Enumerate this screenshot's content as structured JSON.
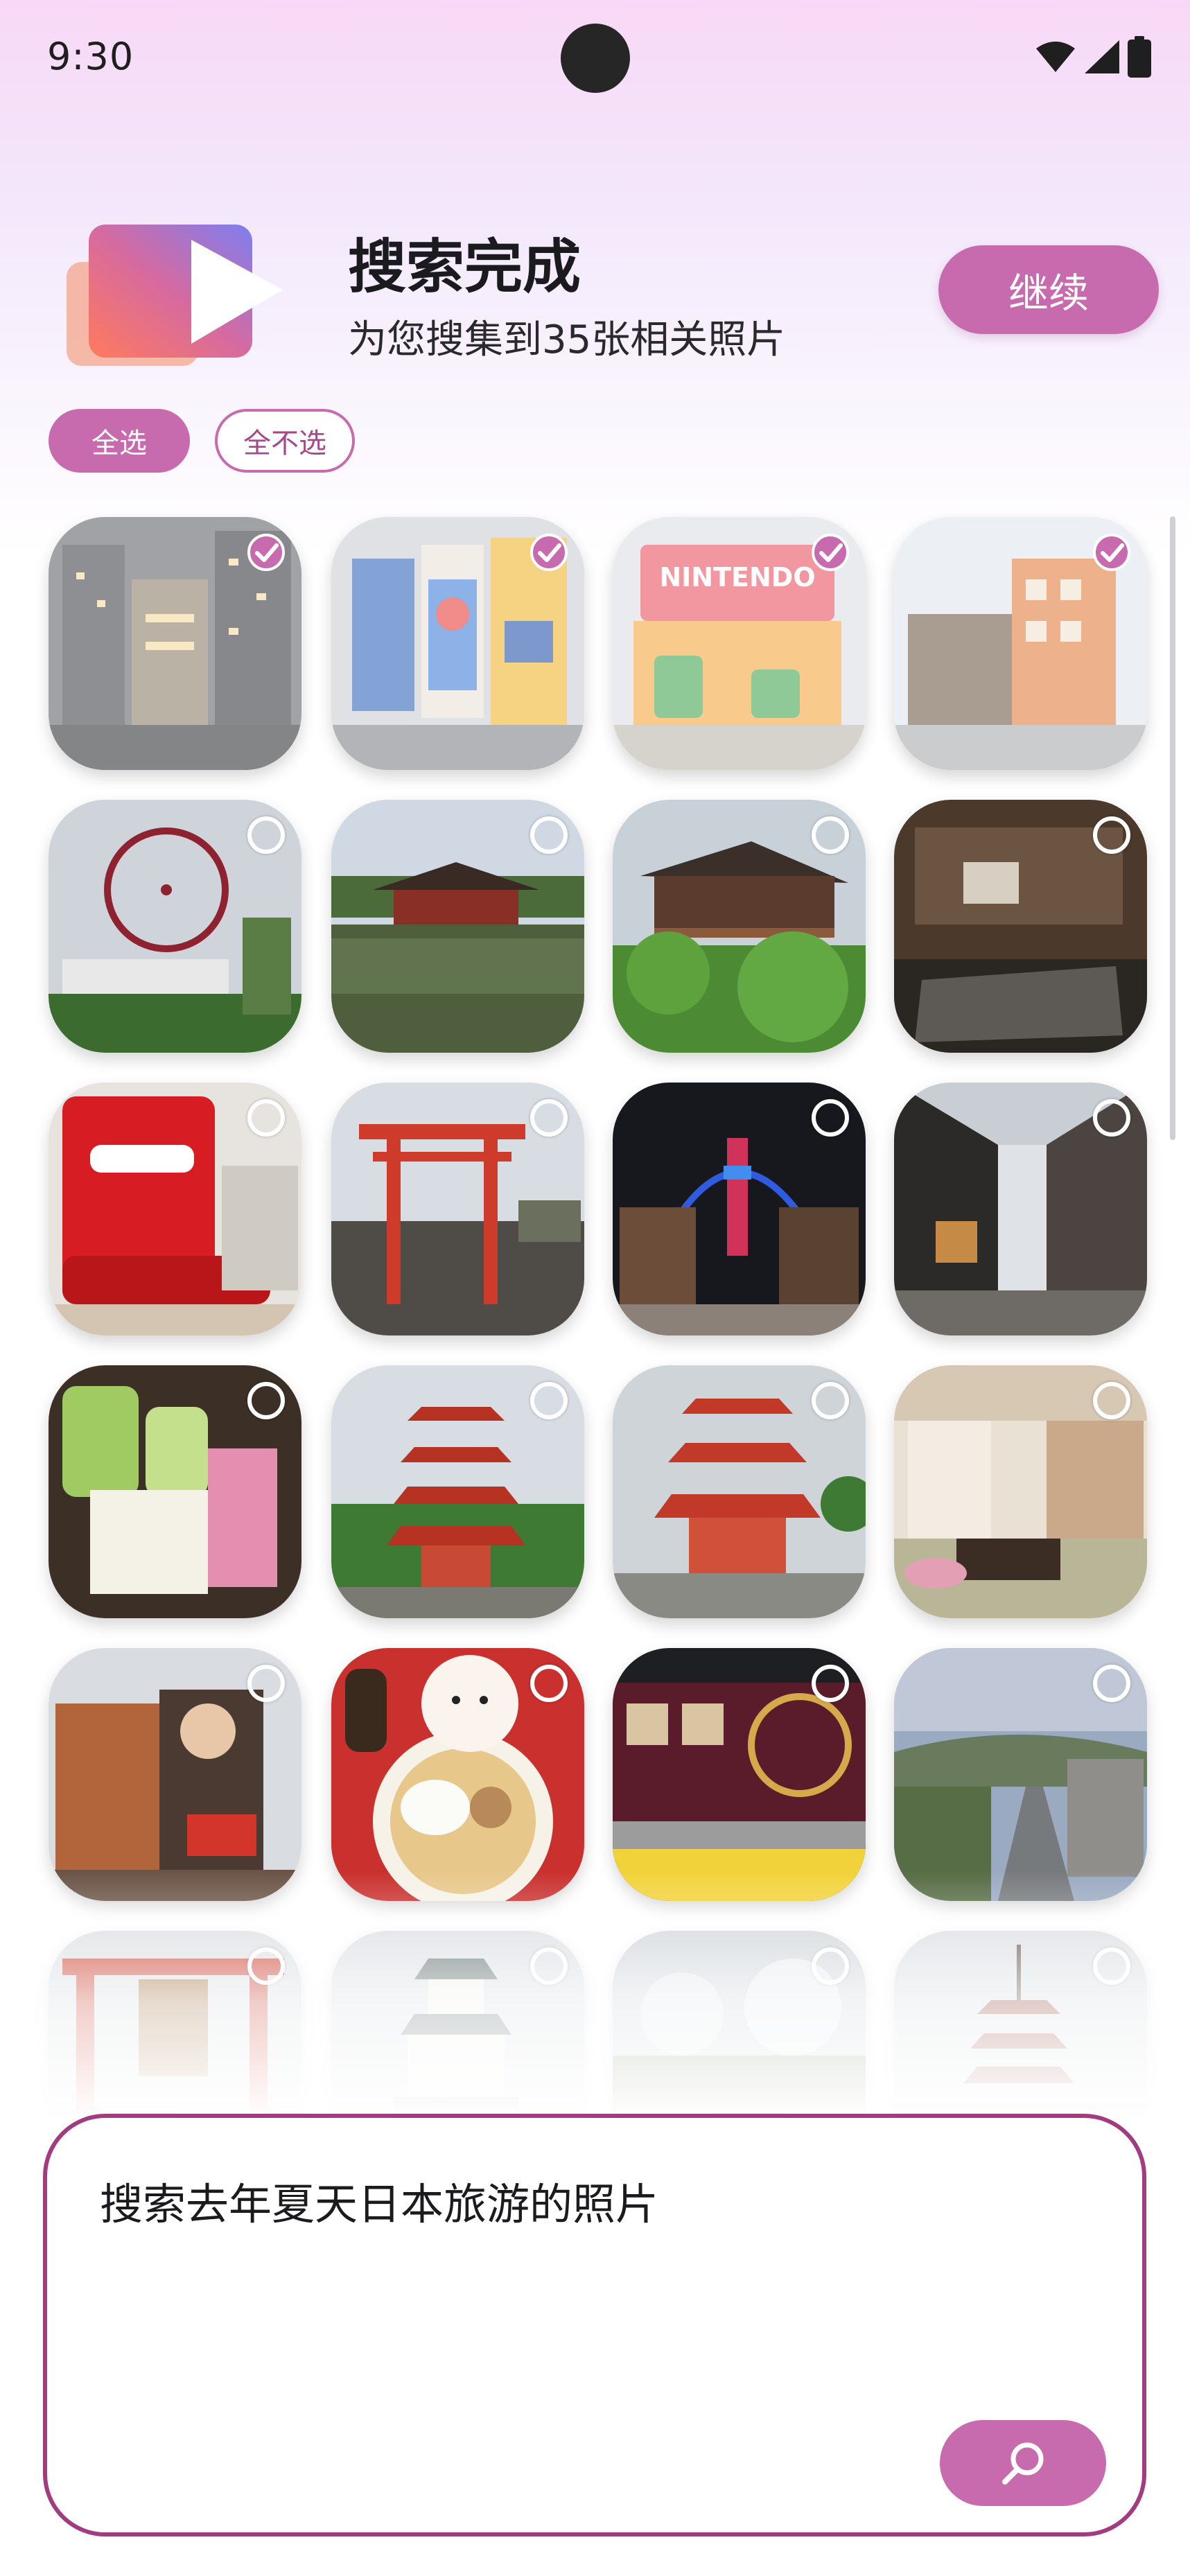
{
  "status_bar": {
    "time": "9:30"
  },
  "header": {
    "title": "搜索完成",
    "subtitle": "为您搜集到35张相关照片",
    "continue_label": "继续",
    "logo_icon": "play-logo-icon"
  },
  "selection": {
    "select_all_label": "全选",
    "select_none_label": "全不选"
  },
  "photos": [
    {
      "scene": "city-night-buildings",
      "selected": true
    },
    {
      "scene": "dotonbori-billboards",
      "selected": true
    },
    {
      "scene": "nintendo-world-entrance",
      "selected": true
    },
    {
      "scene": "street-old-buildings",
      "selected": true
    },
    {
      "scene": "ferris-wheel",
      "selected": false
    },
    {
      "scene": "byodoin-temple-pond",
      "selected": false
    },
    {
      "scene": "kiyomizu-temple-forest",
      "selected": false
    },
    {
      "scene": "dark-interior-room",
      "selected": false
    },
    {
      "scene": "nintendo-osaka-store",
      "selected": false
    },
    {
      "scene": "red-torii-gate",
      "selected": false
    },
    {
      "scene": "tsutenkaku-night-street",
      "selected": false
    },
    {
      "scene": "narrow-alley",
      "selected": false
    },
    {
      "scene": "matcha-drinks-table",
      "selected": false
    },
    {
      "scene": "red-pagoda-trees",
      "selected": false
    },
    {
      "scene": "red-pagoda-cloudy",
      "selected": false
    },
    {
      "scene": "tatami-room",
      "selected": false
    },
    {
      "scene": "anime-display",
      "selected": false
    },
    {
      "scene": "ramen-bowl",
      "selected": false
    },
    {
      "scene": "hankyu-train",
      "selected": false
    },
    {
      "scene": "city-street-sunset",
      "selected": false
    },
    {
      "scene": "fushimi-inari-gates",
      "selected": false
    },
    {
      "scene": "osaka-castle",
      "selected": false
    },
    {
      "scene": "cloudy-landscape",
      "selected": false
    },
    {
      "scene": "pagoda-distant",
      "selected": false
    }
  ],
  "query": {
    "text": "搜索去年夏天日本旅游的照片",
    "search_icon": "search-icon"
  },
  "colors": {
    "accent": "#c76bae",
    "accent_dark": "#a23b7f"
  }
}
